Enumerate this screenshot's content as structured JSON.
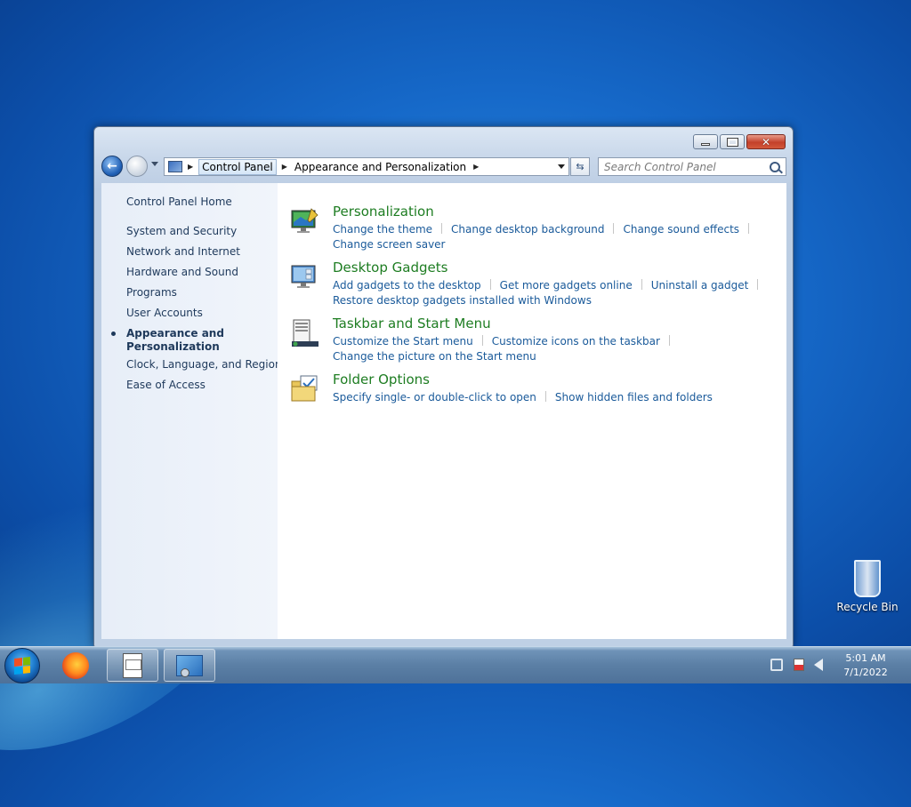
{
  "window": {
    "nav": {
      "breadcrumbs": [
        "Control Panel",
        "Appearance and Personalization"
      ],
      "search_placeholder": "Search Control Panel"
    },
    "left_nav": {
      "home": "Control Panel Home",
      "items": [
        "System and Security",
        "Network and Internet",
        "Hardware and Sound",
        "Programs",
        "User Accounts",
        "Appearance and Personalization",
        "Clock, Language, and Region",
        "Ease of Access"
      ],
      "active_index": 5
    },
    "categories": [
      {
        "title": "Personalization",
        "icon": "personalization-icon",
        "links": [
          "Change the theme",
          "Change desktop background",
          "Change sound effects",
          "Change screen saver"
        ]
      },
      {
        "title": "Desktop Gadgets",
        "icon": "gadgets-icon",
        "links": [
          "Add gadgets to the desktop",
          "Get more gadgets online",
          "Uninstall a gadget",
          "Restore desktop gadgets installed with Windows"
        ]
      },
      {
        "title": "Taskbar and Start Menu",
        "icon": "taskbar-icon",
        "links": [
          "Customize the Start menu",
          "Customize icons on the taskbar",
          "Change the picture on the Start menu"
        ]
      },
      {
        "title": "Folder Options",
        "icon": "folder-options-icon",
        "links": [
          "Specify single- or double-click to open",
          "Show hidden files and folders"
        ]
      }
    ]
  },
  "desktop": {
    "recycle_bin": "Recycle Bin"
  },
  "taskbar": {
    "time": "5:01 AM",
    "date": "7/1/2022"
  },
  "colors": {
    "category_title": "#1e7d22",
    "link": "#1a5a9a",
    "left_nav_text": "#1e395b"
  }
}
